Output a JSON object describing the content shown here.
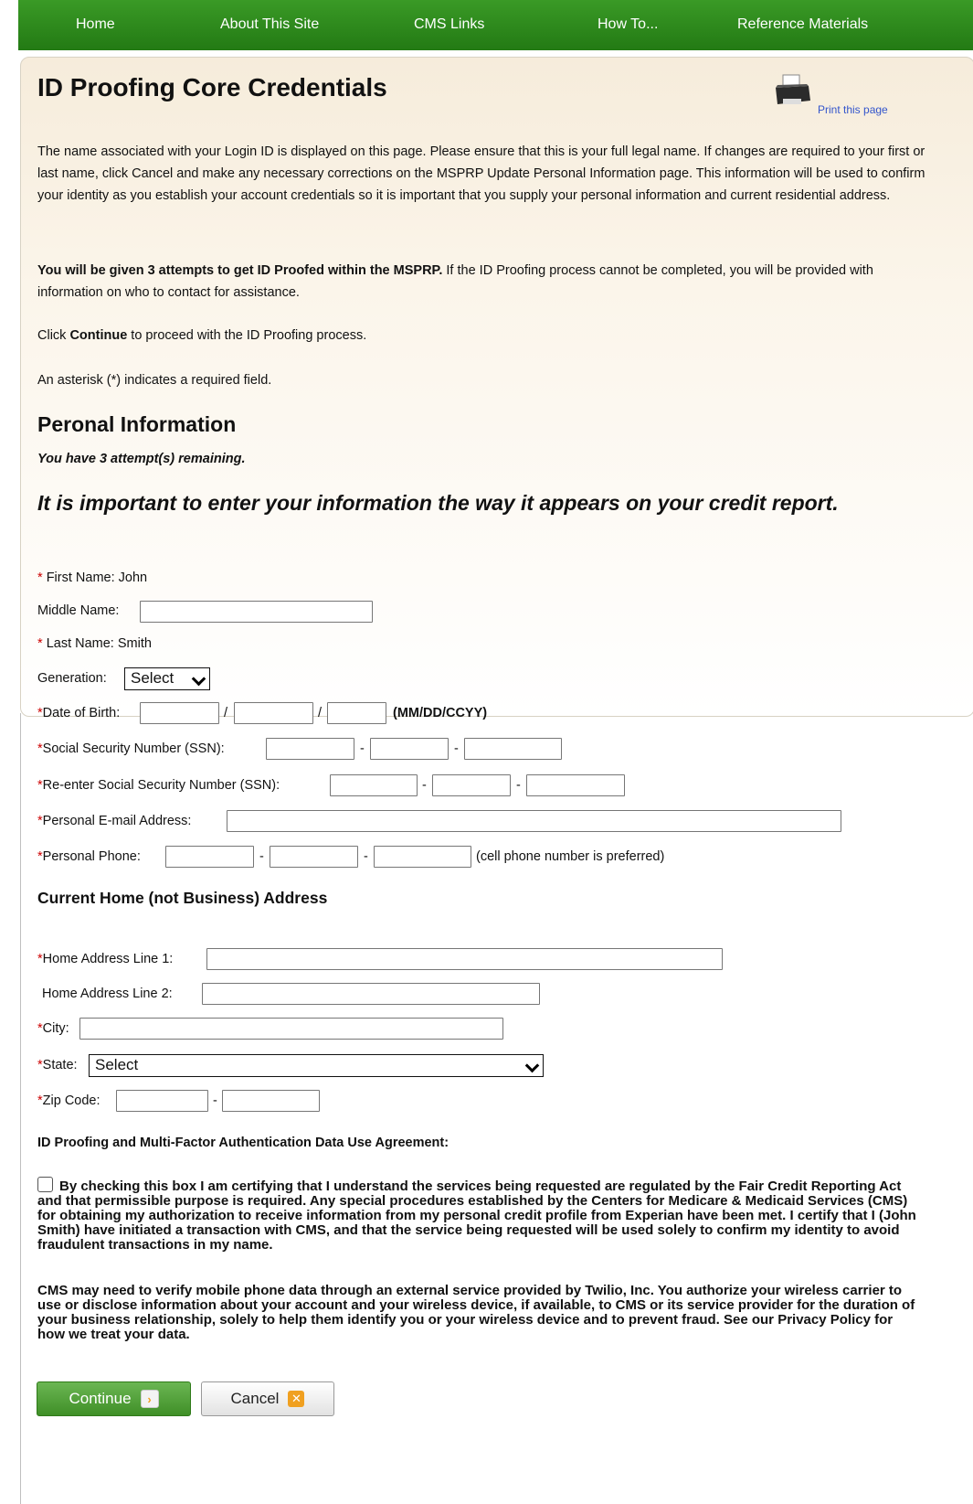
{
  "nav": {
    "items": [
      "Home",
      "About This Site",
      "CMS Links",
      "How To...",
      "Reference Materials"
    ]
  },
  "page": {
    "title": "ID Proofing Core Credentials",
    "print_label": "Print this page",
    "intro_para1": "The name associated with your Login ID is displayed on this page. Please ensure that this is your full legal name. If changes are required to your first or last name, click Cancel and make any necessary corrections on the MSPRP Update Personal Information page. This information will be used to confirm your identity as you establish your account credentials so it is important that you supply your personal information and current residential address.",
    "intro_para2_bold": "You will be given 3 attempts to get ID Proofed within the MSPRP.",
    "intro_para2_rest": " If the ID Proofing process cannot be completed, you will be provided with information on who to contact for assistance.",
    "intro_para3_pre": "Click ",
    "intro_para3_bold": "Continue",
    "intro_para3_post": " to proceed with the ID Proofing process.",
    "asterisk_note": "An asterisk (*) indicates a required field."
  },
  "personal": {
    "heading": "Peronal Information",
    "attempts_note": "You have 3 attempt(s) remaining.",
    "important_note": "It is important to enter your information the way it appears on your credit report.",
    "first_name_label": "First Name: John",
    "middle_name_label": "Middle Name:",
    "last_name_label": "Last Name: Smith",
    "generation_label": "Generation:",
    "generation_value": "Select",
    "dob_label": "Date of Birth:",
    "dob_format": "(MM/DD/CCYY)",
    "ssn_label": "Social Security Number (SSN):",
    "ssn_reenter_label": "Re-enter Social Security Number (SSN):",
    "email_label": "Personal E-mail Address:",
    "phone_label": "Personal Phone:",
    "phone_note": "(cell phone number is preferred)",
    "asterisk": "*",
    "slash": "/",
    "dash": "-"
  },
  "address": {
    "heading": "Current Home (not Business) Address",
    "line1_label": "Home Address Line 1:",
    "line2_label": "Home Address Line 2:",
    "city_label": "City:",
    "state_label": "State:",
    "state_value": "Select",
    "zip_label": "Zip Code:"
  },
  "agreement": {
    "heading": "ID Proofing and Multi-Factor Authentication Data Use Agreement:",
    "text1": "By checking this box I am certifying that I understand the services being requested are regulated by the Fair Credit Reporting Act and that permissible purpose is required. Any special procedures established by the Centers for Medicare & Medicaid Services (CMS) for obtaining my authorization to receive information from my personal credit profile from Experian have been met. I certify that I (John  Smith) have initiated a transaction with CMS, and that the service being requested will be used solely to confirm my identity to avoid fraudulent transactions in my name.",
    "text2": "CMS may need to verify mobile phone data through an external service provided by Twilio, Inc. You authorize your wireless carrier to use or disclose information about your account and your wireless device, if available, to CMS or its service provider for the duration of your business relationship, solely to help them identify you or your wireless device and to prevent fraud. See our Privacy Policy for how we treat your data."
  },
  "buttons": {
    "continue_label": "Continue",
    "cancel_label": "Cancel"
  },
  "colors": {
    "nav_green": "#2c8a1c",
    "required_red": "#cc0000",
    "link_blue": "#3355cc",
    "cancel_icon_orange": "#f0a020"
  }
}
